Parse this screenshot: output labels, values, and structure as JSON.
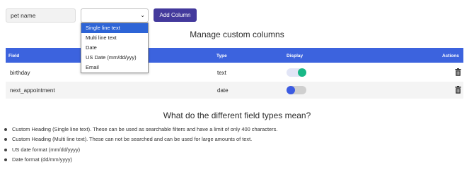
{
  "form": {
    "name_value": "pet name",
    "select_value": "",
    "add_button_label": "Add Column"
  },
  "dropdown": {
    "options": [
      "Single line text",
      "Multi line text",
      "Date",
      "US Date (mm/dd/yyy)",
      "Email"
    ],
    "highlighted_index": 0
  },
  "main_heading": "Manage custom columns",
  "table": {
    "columns": [
      "Field",
      "Type",
      "Display",
      "Actions"
    ],
    "rows": [
      {
        "field": "birthday",
        "type": "text",
        "display": true,
        "action_icon": "trash-icon"
      },
      {
        "field": "next_appointment",
        "type": "date",
        "display": false,
        "action_icon": "trash-icon"
      }
    ]
  },
  "explanations": {
    "heading": "What do the different field types mean?",
    "items": [
      "Custom Heading (Single line text). These can be used as searchable filters and have a limit of only 400 characters.",
      "Custom Heading (Multi line text). These can not be searched and can be used for large amounts of text.",
      "US date format (mm/dd/yyyy)",
      "Date format (dd/mm/yyyy)"
    ]
  },
  "colors": {
    "primary_button": "#43399c",
    "table_header": "#3c63de",
    "toggle_on": "#19b887",
    "toggle_off_knob": "#3c5be2",
    "dropdown_highlight": "#2d64d6"
  }
}
